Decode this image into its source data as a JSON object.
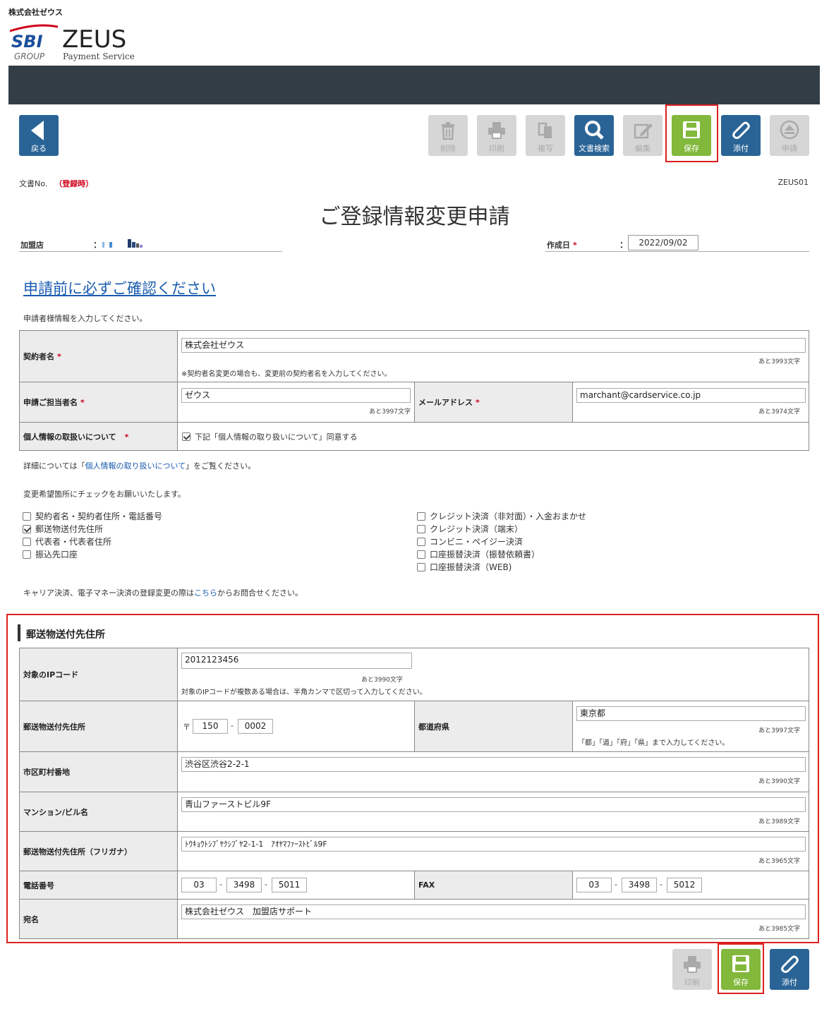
{
  "header": {
    "company": "株式会社ゼウス",
    "logo": {
      "sbi": "SBI",
      "group": "GROUP",
      "brand": "ZEUS",
      "tagline": "Payment Service"
    }
  },
  "toolbar": {
    "back": "戻る",
    "delete": "削除",
    "print": "印刷",
    "copy": "複写",
    "search": "文書検索",
    "edit": "編集",
    "save": "保存",
    "attach": "添付",
    "apply": "申請"
  },
  "doc": {
    "no_label": "文書No.",
    "no_value": "（登録時）",
    "code": "ZEUS01",
    "title": "ご登録情報変更申請"
  },
  "meta": {
    "merchant_label": "加盟店",
    "colon": "：",
    "created_label": "作成日",
    "created_value": "2022/09/02"
  },
  "confirm_link": "申請前に必ずご確認ください",
  "intro": "申請者様情報を入力してください。",
  "applicant": {
    "required_mark": "*",
    "contractor_label": "契約者名",
    "contractor_value": "株式会社ゼウス",
    "contractor_count": "あと3993文字",
    "contractor_note": "※契約者名変更の場合も、変更前の契約者名を入力してください。",
    "person_label": "申請ご担当者名",
    "person_value": "ゼウス",
    "person_count": "あと3997文字",
    "email_label": "メールアドレス",
    "email_value": "marchant@cardservice.co.jp",
    "email_count": "あと3974文字",
    "privacy_label": "個人情報の取扱いについて",
    "privacy_check": "下記「個人情報の取り扱いについて」同意する"
  },
  "details": {
    "pre": "詳細については「",
    "link": "個人情報の取り扱いについて",
    "post": "」をご覧ください。"
  },
  "check_intro": "変更希望箇所にチェックをお願いいたします。",
  "checks_left": [
    {
      "label": "契約者名・契約者住所・電話番号",
      "checked": false
    },
    {
      "label": "郵送物送付先住所",
      "checked": true
    },
    {
      "label": "代表者・代表者住所",
      "checked": false
    },
    {
      "label": "振込先口座",
      "checked": false
    }
  ],
  "checks_right": [
    {
      "label": "クレジット決済（非対面）・入金おまかせ",
      "checked": false
    },
    {
      "label": "クレジット決済（端末）",
      "checked": false
    },
    {
      "label": "コンビニ・ペイジー決済",
      "checked": false
    },
    {
      "label": "口座振替決済（振替依頼書）",
      "checked": false
    },
    {
      "label": "口座振替決済（WEB)",
      "checked": false
    }
  ],
  "carrier": {
    "pre": "キャリア決済、電子マネー決済の登録変更の際は",
    "link": "こちら",
    "post": "からお問合せください。"
  },
  "mail_section": {
    "title": "郵送物送付先住所",
    "ip_label": "対象のIPコード",
    "ip_value": "2012123456",
    "ip_count": "あと3990文字",
    "ip_note": "対象のIPコードが複数ある場合は、半角カンマで区切って入力してください。",
    "addr_label": "郵送物送付先住所",
    "postal_mark": "〒",
    "postal1": "150",
    "postal2": "0002",
    "dash": "-",
    "pref_label": "都道府県",
    "pref_value": "東京都",
    "pref_count": "あと3997文字",
    "pref_note": "「都」「道」「府」「県」まで入力してください。",
    "city_label": "市区町村番地",
    "city_value": "渋谷区渋谷2-2-1",
    "city_count": "あと3990文字",
    "bldg_label": "マンション/ビル名",
    "bldg_value": "青山ファーストビル9F",
    "bldg_count": "あと3989文字",
    "kana_label": "郵送物送付先住所（フリガナ）",
    "kana_value": "ﾄｳｷｮｳﾄｼﾌﾞﾔｸｼﾌﾞﾔ2-1-1　ｱｵﾔﾏﾌｧｰｽﾄﾋﾞﾙ9F",
    "kana_count": "あと3965文字",
    "tel_label": "電話番号",
    "tel": [
      "03",
      "3498",
      "5011"
    ],
    "fax_label": "FAX",
    "fax": [
      "03",
      "3498",
      "5012"
    ],
    "addressee_label": "宛名",
    "addressee_value": "株式会社ゼウス　加盟店サポート",
    "addressee_count": "あと3985文字"
  },
  "bottom_toolbar": {
    "print": "印刷",
    "save": "保存",
    "attach": "添付"
  },
  "colors": {
    "header": "#333d45",
    "accent_blue": "#2a6496",
    "save_green": "#82b83b",
    "highlight_red": "#dd2020",
    "required_red": "#d0021b"
  }
}
